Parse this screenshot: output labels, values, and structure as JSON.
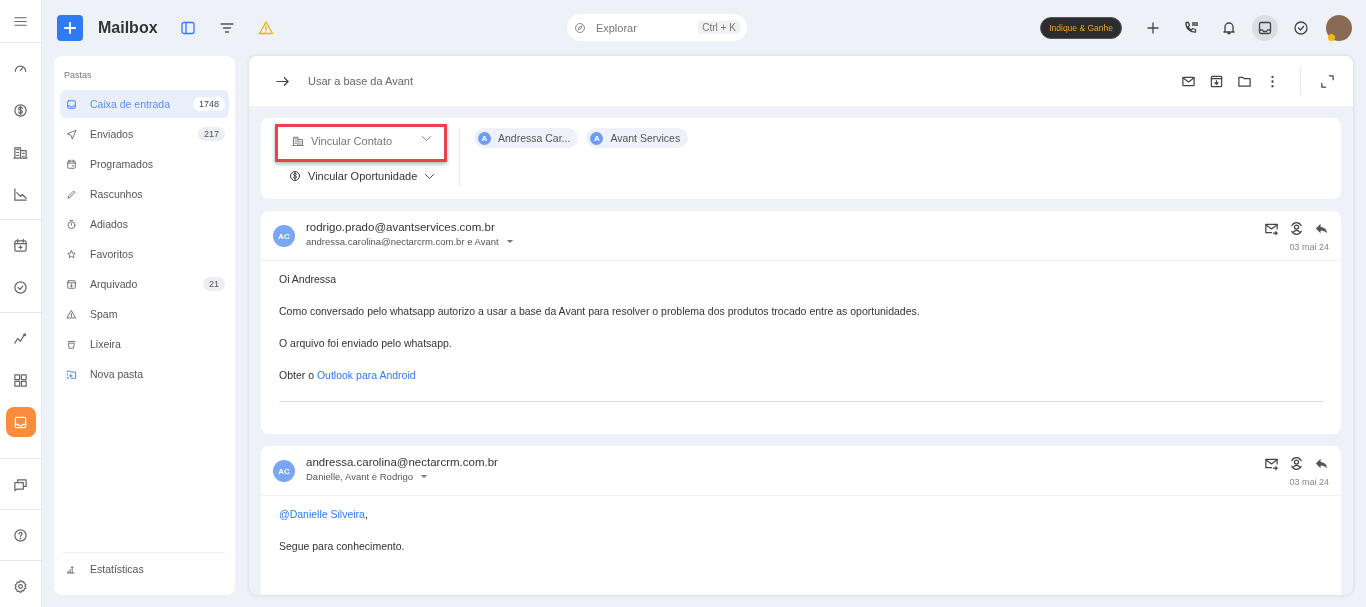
{
  "rail": {
    "items": [
      {
        "selected": false
      },
      {
        "selected": false
      },
      {
        "selected": false
      },
      {
        "selected": false
      },
      {
        "selected": false
      },
      {
        "selected": false
      },
      {
        "selected": false
      },
      {
        "selected": false
      },
      {
        "selected": true
      }
    ]
  },
  "topbar": {
    "title": "Mailbox",
    "search": {
      "placeholder": "Explorar",
      "shortcut": "Ctrl + K"
    },
    "promo_button": "Indique & Ganhe"
  },
  "folders": {
    "heading": "Pastas",
    "items": [
      {
        "label": "Caixa de entrada",
        "count": "1748",
        "selected": true,
        "kind": "folder"
      },
      {
        "label": "Enviados",
        "count": "217",
        "selected": false,
        "kind": "folder"
      },
      {
        "label": "Programados",
        "selected": false,
        "kind": "folder"
      },
      {
        "label": "Rascunhos",
        "selected": false,
        "kind": "folder"
      },
      {
        "label": "Adiados",
        "selected": false,
        "kind": "folder"
      },
      {
        "label": "Favoritos",
        "selected": false,
        "kind": "folder"
      },
      {
        "label": "Arquivado",
        "count": "21",
        "selected": false,
        "kind": "folder"
      },
      {
        "label": "Spam",
        "selected": false,
        "kind": "folder"
      },
      {
        "label": "Lixeira",
        "selected": false,
        "kind": "folder"
      },
      {
        "label": "Nova pasta",
        "selected": false,
        "kind": "action"
      }
    ],
    "footer": "Estatísticas"
  },
  "thread": {
    "subject": "Usar a base da Avant",
    "links": [
      {
        "label": "Vincular Contato",
        "highlighted": true
      },
      {
        "label": "Vincular Oportunidade",
        "highlighted": false
      }
    ],
    "contacts": [
      {
        "initial": "A",
        "name": "Andressa Car..."
      },
      {
        "initial": "A",
        "name": "Avant Services"
      }
    ],
    "messages": [
      {
        "avatar": "AC",
        "from": "rodrigo.prado@avantservices.com.br",
        "to": "andressa.carolina@nectarcrm.com.br e Avant",
        "date": "03 mai 24",
        "signature_rule": true,
        "paragraphs": [
          {
            "parts": [
              {
                "kind": "text",
                "text": "Oi Andressa"
              }
            ]
          },
          {
            "parts": [
              {
                "kind": "text",
                "text": "Como conversado pelo whatsapp autorizo a usar a base da Avant para resolver o problema dos produtos trocado entre as oportunidades."
              }
            ]
          },
          {
            "parts": [
              {
                "kind": "text",
                "text": "O arquivo foi enviado pelo whatsapp."
              }
            ]
          },
          {
            "parts": [
              {
                "kind": "text",
                "text": "Obter o "
              },
              {
                "kind": "link",
                "text": "Outlook para Android"
              }
            ]
          }
        ]
      },
      {
        "avatar": "AC",
        "from": "andressa.carolina@nectarcrm.com.br",
        "to": "Danielle, Avant e Rodrigo",
        "date": "03 mai 24",
        "signature_rule": false,
        "paragraphs": [
          {
            "parts": [
              {
                "kind": "link",
                "text": "@Danielle Silveira"
              },
              {
                "kind": "text",
                "text": ","
              }
            ]
          },
          {
            "parts": [
              {
                "kind": "text",
                "text": "Segue para conhecimento."
              }
            ]
          }
        ]
      }
    ]
  }
}
